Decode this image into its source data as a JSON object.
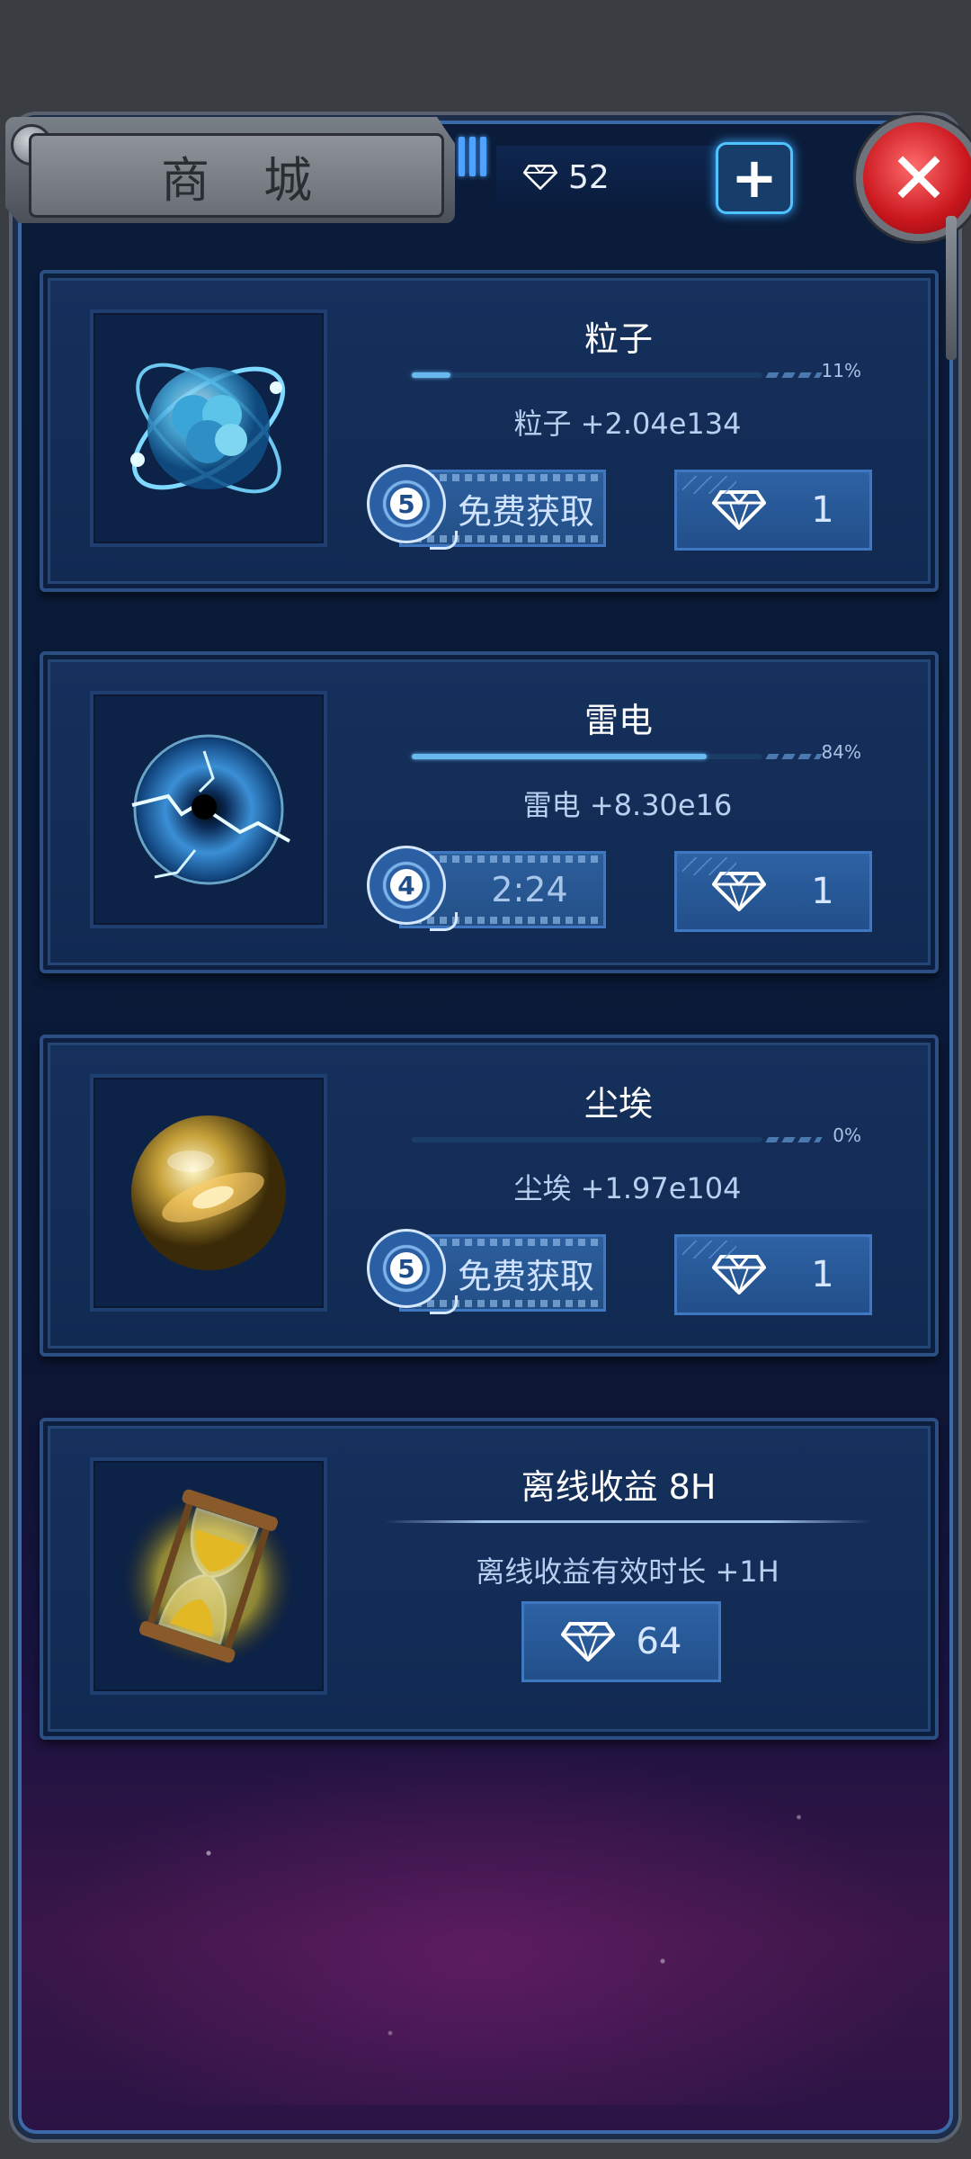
{
  "header": {
    "title": "商城",
    "gem_count": "52"
  },
  "items": [
    {
      "name": "粒子",
      "progress_pct_label": "11%",
      "progress": 0.11,
      "effect": "粒子  +2.04e134",
      "free_label": "免费获取",
      "badge": "5",
      "gem_cost": "1"
    },
    {
      "name": "雷电",
      "progress_pct_label": "84%",
      "progress": 0.84,
      "effect": "雷电  +8.30e16",
      "free_label": "2:24",
      "badge": "4",
      "gem_cost": "1"
    },
    {
      "name": "尘埃",
      "progress_pct_label": "0%",
      "progress": 0.0,
      "effect": "尘埃  +1.97e104",
      "free_label": "免费获取",
      "badge": "5",
      "gem_cost": "1"
    }
  ],
  "offline": {
    "name": "离线收益 8H",
    "effect": "离线收益有效时长  +1H",
    "gem_cost": "64"
  },
  "colors": {
    "accent": "#4fc3ff",
    "close": "#c9161d",
    "panel": "#0b1c3a"
  },
  "icons": {
    "particle": "particle-orb-icon",
    "lightning": "lightning-orb-icon",
    "dust": "dust-orb-icon",
    "hourglass": "hourglass-icon",
    "gem": "diamond-icon",
    "close": "close-icon",
    "plus": "plus-icon"
  }
}
